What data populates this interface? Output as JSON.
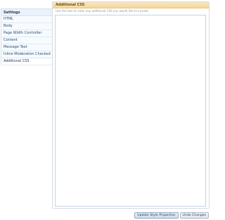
{
  "sidebar": {
    "heading": "Settings",
    "items": [
      {
        "label": "HTML"
      },
      {
        "label": "Body"
      },
      {
        "label": "Page Width Controller"
      },
      {
        "label": "Content"
      },
      {
        "label": "Message Text"
      },
      {
        "label": "Inline Moderation Checked"
      },
      {
        "label": "Additional CSS"
      }
    ],
    "active_item": "Additional CSS"
  },
  "panel": {
    "title": "Additional CSS",
    "explain": "Use this box to enter any additional CSS you would like to include.",
    "textarea_value": ""
  },
  "buttons": {
    "update_label": "Update Style Properties",
    "undo_label": "Undo Changes"
  },
  "colors": {
    "header_bg": "#f5d79c",
    "sidebar_bg": "#f7fbff",
    "border": "#d6dde6"
  }
}
